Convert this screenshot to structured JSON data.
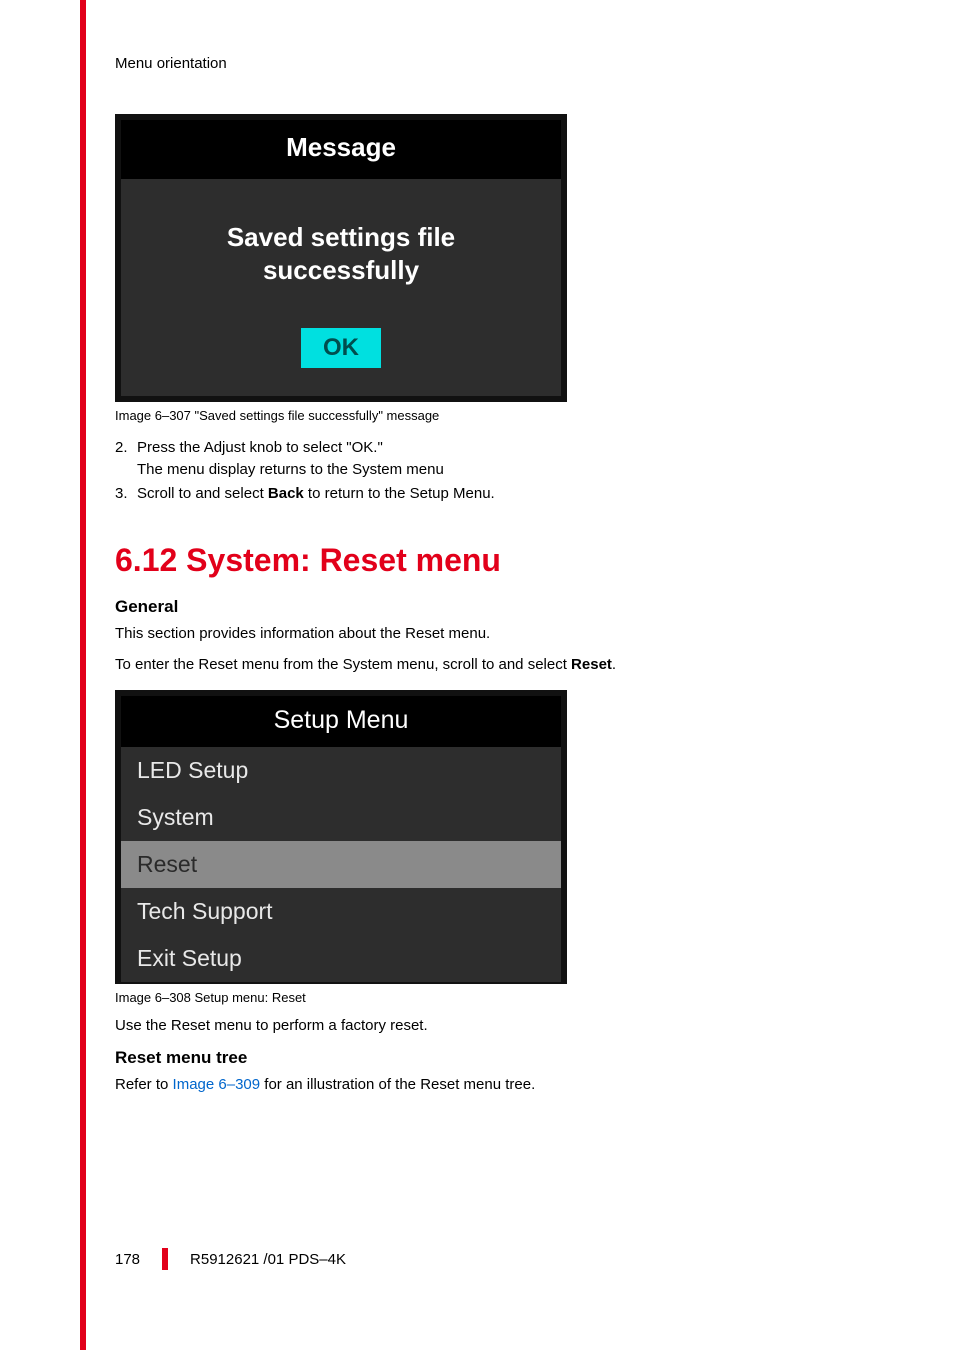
{
  "header": {
    "breadcrumb": "Menu orientation"
  },
  "figure307": {
    "title": "Message",
    "body_line1": "Saved settings file",
    "body_line2": "successfully",
    "ok_label": "OK",
    "caption": "Image 6–307  \"Saved settings file successfully\" message"
  },
  "steps": {
    "s2_num": "2.",
    "s2_line1": "Press the Adjust knob to select \"OK.\"",
    "s2_line2": "The menu display returns to the System menu",
    "s3_num": "3.",
    "s3_pre": "Scroll to and select ",
    "s3_bold": "Back",
    "s3_post": " to return to the Setup Menu."
  },
  "section": {
    "heading": "6.12 System: Reset menu",
    "sub1": "General",
    "p1": "This section provides information about the Reset menu.",
    "p2_pre": "To enter the Reset menu from the System menu, scroll to and select ",
    "p2_bold": "Reset",
    "p2_post": "."
  },
  "figure308": {
    "title": "Setup Menu",
    "items": [
      "LED Setup",
      "System",
      "Reset",
      "Tech Support",
      "Exit Setup"
    ],
    "selected_index": 2,
    "caption": "Image 6–308  Setup menu: Reset"
  },
  "after308": {
    "p1": "Use the Reset menu to perform a factory reset.",
    "sub": "Reset menu tree",
    "p2_pre": "Refer to ",
    "p2_link": "Image 6–309",
    "p2_post": " for an illustration of the Reset menu tree."
  },
  "footer": {
    "page": "178",
    "doc": "R5912621 /01 PDS–4K"
  }
}
